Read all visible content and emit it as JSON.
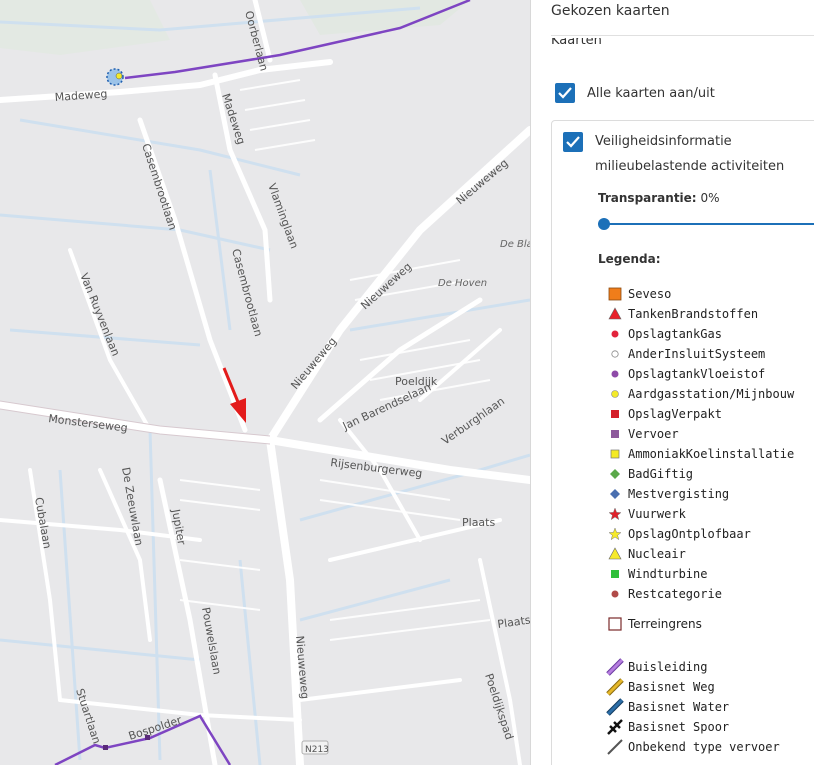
{
  "panel": {
    "header": "Gekozen kaarten",
    "clipped_label": "Kaarten",
    "all_maps_label": "Alle kaarten aan/uit",
    "all_maps_checked": true,
    "layer_label_line1": "Veiligheidsinformatie",
    "layer_label_line2": "milieubelastende activiteiten",
    "layer_checked": true,
    "transparency_label": "Transparantie:",
    "transparency_value": "0%",
    "transparency_level": 0,
    "legend_title": "Legenda:",
    "accent_color": "#1c70b8"
  },
  "legend": [
    {
      "label": "Seveso",
      "icon": "orange-square-icon",
      "color": "#f07d1a"
    },
    {
      "label": "TankenBrandstoffen",
      "icon": "red-triangle-icon",
      "color": "#e8212b"
    },
    {
      "label": "OpslagtankGas",
      "icon": "red-dot-icon",
      "color": "#e2233c"
    },
    {
      "label": "AnderInsluitSysteem",
      "icon": "white-dot-icon",
      "color": "#ffffff"
    },
    {
      "label": "OpslagtankVloeistof",
      "icon": "purple-dot-icon",
      "color": "#8e4aa8"
    },
    {
      "label": "Aardgasstation/Mijnbouw",
      "icon": "yellow-dot-icon",
      "color": "#f3ea2a"
    },
    {
      "label": "OpslagVerpakt",
      "icon": "red-square-icon",
      "color": "#d41f2a"
    },
    {
      "label": "Vervoer",
      "icon": "purple-square-icon",
      "color": "#8e5a9c"
    },
    {
      "label": "AmmoniakKoelinstallatie",
      "icon": "yellow-square-icon",
      "color": "#f4ea23"
    },
    {
      "label": "BadGiftig",
      "icon": "green-diamond-icon",
      "color": "#5aa84a"
    },
    {
      "label": "Mestvergisting",
      "icon": "blue-diamond-icon",
      "color": "#4a6fb0"
    },
    {
      "label": "Vuurwerk",
      "icon": "red-star-icon",
      "color": "#e0202a"
    },
    {
      "label": "OpslagOntplofbaar",
      "icon": "yellow-star-icon",
      "color": "#f6ea2a"
    },
    {
      "label": "Nucleair",
      "icon": "yellow-triangle-icon",
      "color": "#f6ea2a"
    },
    {
      "label": "Windturbine",
      "icon": "green-square-icon",
      "color": "#2fbf3a"
    },
    {
      "label": "Restcategorie",
      "icon": "brown-dot-icon",
      "color": "#b04a48"
    }
  ],
  "boundary_legend": {
    "label": "Terreingrens",
    "icon": "boundary-square-icon",
    "color": "#7a2a2a"
  },
  "line_legend": [
    {
      "label": "Buisleiding",
      "icon": "purple-line-icon",
      "color": "#b77ee0"
    },
    {
      "label": "Basisnet Weg",
      "icon": "yellow-line-icon",
      "color": "#e6b82a"
    },
    {
      "label": "Basisnet Water",
      "icon": "blue-line-icon",
      "color": "#2d6fa8"
    },
    {
      "label": "Basisnet Spoor",
      "icon": "rail-line-icon",
      "color": "#111111"
    },
    {
      "label": "Onbekend type vervoer",
      "icon": "grey-line-icon",
      "color": "#555555"
    }
  ],
  "map": {
    "street_labels": [
      "Madeweg",
      "Oorberlaan",
      "Madeweg",
      "Casembrootlaan",
      "Vlaminglaan",
      "Casembrootlaan",
      "Van Ruyvenlaan",
      "Nieuweweg",
      "Nieuweweg",
      "Nieuweweg",
      "De Blauwe",
      "De Hoven",
      "Poeldijk",
      "Jan Barendselaan",
      "Verburghlaan",
      "Monsterseweg",
      "Rijsenburgerweg",
      "De Zeeuwlaan",
      "Cubalaan",
      "Jupiter",
      "Plaats",
      "Pouwelslaan",
      "Nieuweweg",
      "Plaats",
      "Poeldijkspad",
      "Stuartlaan",
      "Bospolder",
      "N213"
    ],
    "marker": "red-arrow-icon"
  }
}
